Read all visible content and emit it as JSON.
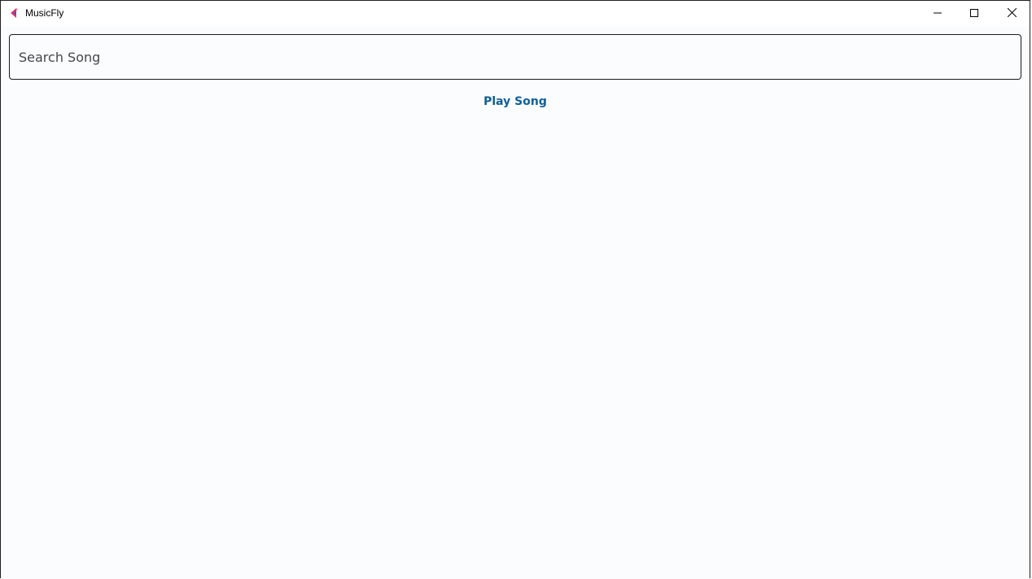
{
  "window": {
    "title": "MusicFly",
    "icon": "musicfly-logo-icon",
    "controls": {
      "minimize": "minimize-icon",
      "maximize": "maximize-icon",
      "close": "close-icon"
    }
  },
  "search": {
    "placeholder": "Search Song",
    "value": ""
  },
  "actions": {
    "play_label": "Play Song"
  },
  "colors": {
    "accent": "#0f5f97",
    "logo_pink": "#e2336b",
    "logo_blue": "#1b66c9",
    "background": "#fbfcfe"
  }
}
